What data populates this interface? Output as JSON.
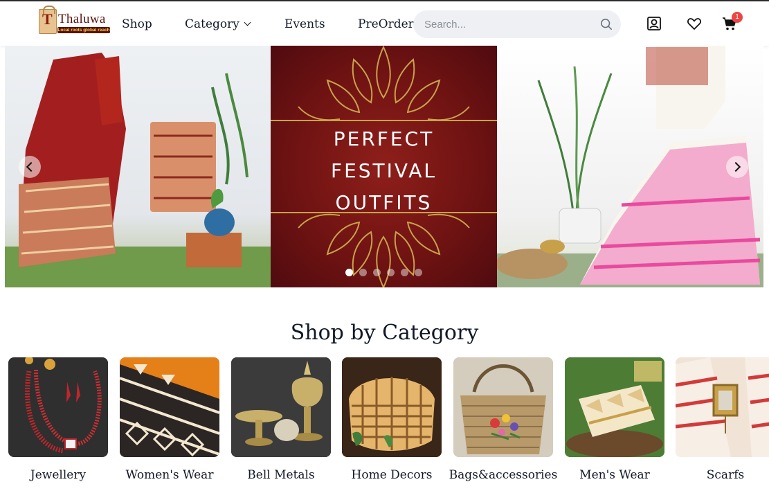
{
  "brand": {
    "name": "Thaluwa",
    "tagline": "Local roots global reach",
    "logo_letter": "T"
  },
  "nav": {
    "items": [
      {
        "label": "Shop"
      },
      {
        "label": "Category"
      },
      {
        "label": "Events"
      },
      {
        "label": "PreOrder"
      }
    ]
  },
  "search": {
    "placeholder": "Search..."
  },
  "header_icons": [
    "user-icon",
    "heart-icon",
    "cart-icon"
  ],
  "cart": {
    "count": "1"
  },
  "hero": {
    "lines": [
      "PERFECT",
      "FESTIVAL",
      "OUTFITS"
    ],
    "slide_count": 6,
    "active_slide": 1
  },
  "section": {
    "title": "Shop by Category"
  },
  "categories": [
    {
      "label": "Jewellery"
    },
    {
      "label": "Women's Wear"
    },
    {
      "label": "Bell Metals"
    },
    {
      "label": "Home Decors"
    },
    {
      "label": "Bags&accessories"
    },
    {
      "label": "Men's Wear"
    },
    {
      "label": "Scarfs"
    }
  ],
  "colors": {
    "accent": "#ef4444",
    "hero_maroon": "#6d1212",
    "hero_gold": "#c9a24a",
    "brand_brown": "#5b1208"
  }
}
